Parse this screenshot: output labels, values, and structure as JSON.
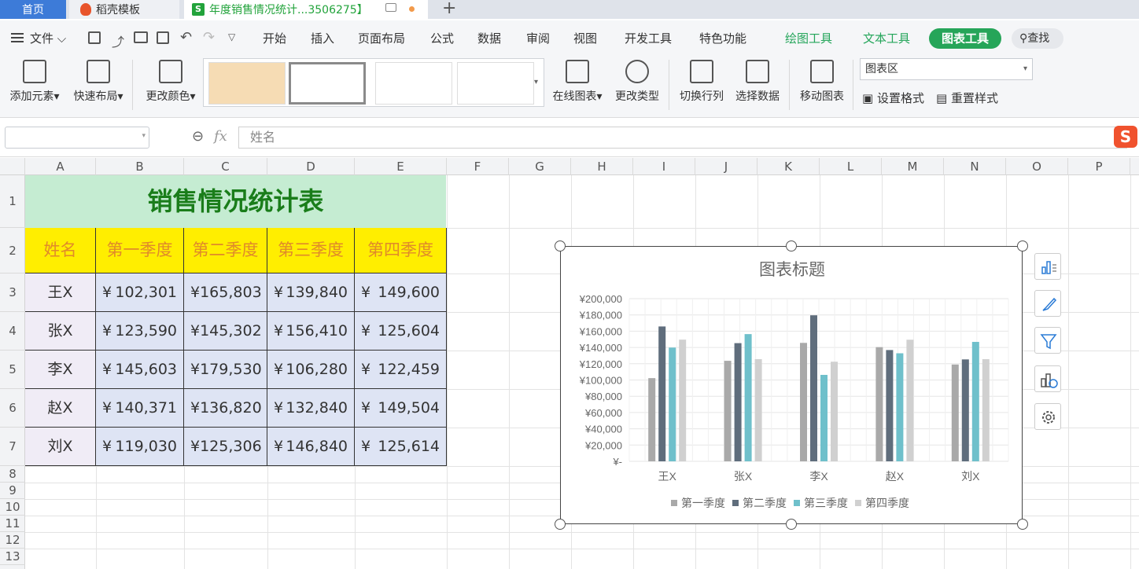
{
  "tabs": {
    "home": "首页",
    "daoke": "稻壳模板",
    "doc": "年度销售情况统计...3506275】",
    "add": "+"
  },
  "menu": {
    "file": "文件",
    "items": [
      "开始",
      "插入",
      "页面布局",
      "公式",
      "数据",
      "审阅",
      "视图",
      "开发工具",
      "特色功能"
    ],
    "draw_tools": "绘图工具",
    "text_tools": "文本工具",
    "chart_tools": "图表工具",
    "search": "查找"
  },
  "ribbon": {
    "add_element": "添加元素",
    "quick_layout": "快速布局",
    "change_color": "更改颜色",
    "online_chart": "在线图表",
    "change_type": "更改类型",
    "switch_rowcol": "切换行列",
    "select_data": "选择数据",
    "move_chart": "移动图表",
    "chart_area": "图表区",
    "set_format": "设置格式",
    "reset_style": "重置样式"
  },
  "formula": {
    "fx": "fx",
    "value": "姓名"
  },
  "columns": [
    "A",
    "B",
    "C",
    "D",
    "E",
    "F",
    "G",
    "H",
    "I",
    "J",
    "K",
    "L",
    "M",
    "N",
    "O",
    "P"
  ],
  "rows": [
    "1",
    "2",
    "3",
    "4",
    "5",
    "6",
    "7",
    "8",
    "9",
    "10",
    "11",
    "12",
    "13"
  ],
  "table": {
    "title": "销售情况统计表",
    "headers": [
      "姓名",
      "第一季度",
      "第二季度",
      "第三季度",
      "第四季度"
    ],
    "currency": "¥",
    "data": [
      {
        "name": "王X",
        "values": [
          "102,301",
          "165,803",
          "139,840",
          "149,600"
        ]
      },
      {
        "name": "张X",
        "values": [
          "123,590",
          "145,302",
          "156,410",
          "125,604"
        ]
      },
      {
        "name": "李X",
        "values": [
          "145,603",
          "179,530",
          "106,280",
          "122,459"
        ]
      },
      {
        "name": "赵X",
        "values": [
          "140,371",
          "136,820",
          "132,840",
          "149,504"
        ]
      },
      {
        "name": "刘X",
        "values": [
          "119,030",
          "125,306",
          "146,840",
          "125,614"
        ]
      }
    ]
  },
  "chart_data": {
    "type": "bar",
    "title": "图表标题",
    "categories": [
      "王X",
      "张X",
      "李X",
      "赵X",
      "刘X"
    ],
    "series": [
      {
        "name": "第一季度",
        "values": [
          102301,
          123590,
          145603,
          140371,
          119030
        ],
        "color": "#a9a9a9"
      },
      {
        "name": "第二季度",
        "values": [
          165803,
          145302,
          179530,
          136820,
          125306
        ],
        "color": "#5f6d7c"
      },
      {
        "name": "第三季度",
        "values": [
          139840,
          156410,
          106280,
          132840,
          146840
        ],
        "color": "#6fc0cb"
      },
      {
        "name": "第四季度",
        "values": [
          149600,
          125604,
          122459,
          149504,
          125614
        ],
        "color": "#d0d0d0"
      }
    ],
    "yticks": [
      "¥-",
      "¥20,000",
      "¥40,000",
      "¥60,000",
      "¥80,000",
      "¥100,000",
      "¥120,000",
      "¥140,000",
      "¥160,000",
      "¥180,000",
      "¥200,000"
    ],
    "ylim": [
      0,
      200000
    ],
    "legend": "bottom",
    "grid": true
  }
}
